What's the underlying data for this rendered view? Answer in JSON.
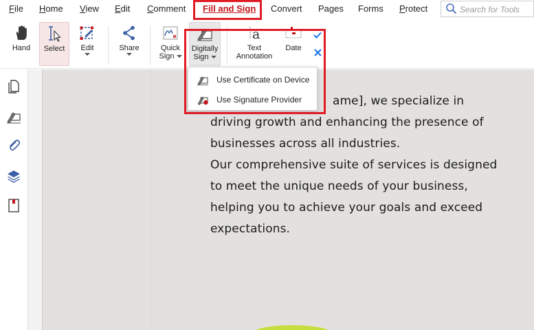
{
  "menu": {
    "items": [
      {
        "label": "File",
        "name": "menu-file"
      },
      {
        "label": "Home",
        "name": "menu-home"
      },
      {
        "label": "View",
        "name": "menu-view"
      },
      {
        "label": "Edit",
        "name": "menu-edit"
      },
      {
        "label": "Comment",
        "name": "menu-comment"
      },
      {
        "label": "Fill and Sign",
        "name": "menu-fill-and-sign"
      },
      {
        "label": "Convert",
        "name": "menu-convert"
      },
      {
        "label": "Pages",
        "name": "menu-pages"
      },
      {
        "label": "Forms",
        "name": "menu-forms"
      },
      {
        "label": "Protect",
        "name": "menu-protect"
      }
    ],
    "active": "Fill and Sign"
  },
  "search": {
    "placeholder": "Search for Tools",
    "icon": "search-icon"
  },
  "toolbar": {
    "hand": "Hand",
    "select": "Select",
    "edit": "Edit",
    "share": "Share",
    "quick_sign_1": "Quick",
    "quick_sign_2": "Sign",
    "digitally_sign_1": "Digitally",
    "digitally_sign_2": "Sign",
    "text_annotation_1": "Text",
    "text_annotation_2": "Annotation",
    "date": "Date"
  },
  "dropdown": {
    "items": [
      {
        "label": "Use Certificate on Device",
        "icon": "certificate-sign-icon"
      },
      {
        "label": "Use Signature Provider",
        "icon": "signature-provider-icon"
      }
    ]
  },
  "document": {
    "lines": [
      "ame], we specialize in",
      "driving growth and enhancing the presence of",
      "businesses across all industries.",
      "Our comprehensive suite of services is designed",
      "to meet the unique needs of your business,",
      "helping you to achieve your goals and exceed",
      "expectations."
    ]
  },
  "colors": {
    "accent": "#c4161c",
    "highlight": "#e01b24",
    "page": "#e3e1df",
    "check": "#1a73e8"
  }
}
